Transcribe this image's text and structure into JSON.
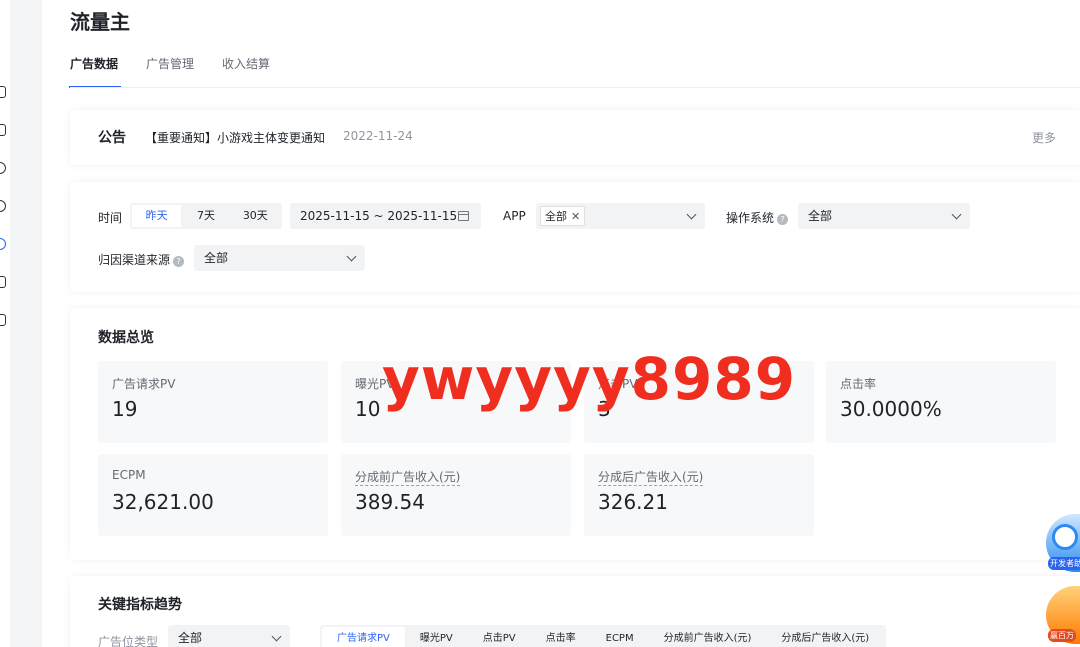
{
  "app": {
    "title": "流量主"
  },
  "tabs": [
    {
      "label": "广告数据",
      "active": true
    },
    {
      "label": "广告管理",
      "active": false
    },
    {
      "label": "收入结算",
      "active": false
    }
  ],
  "notice": {
    "label": "公告",
    "text": "【重要通知】小游戏主体变更通知",
    "date": "2022-11-24",
    "more": "更多"
  },
  "filters": {
    "time_label": "时间",
    "time_options": [
      {
        "label": "昨天",
        "active": true
      },
      {
        "label": "7天",
        "active": false
      },
      {
        "label": "30天",
        "active": false
      }
    ],
    "date_range": "2025-11-15 ~ 2025-11-15",
    "app_label": "APP",
    "app_tag": "全部",
    "os_label": "操作系统",
    "os_value": "全部",
    "channel_label": "归因渠道来源",
    "channel_value": "全部"
  },
  "overview": {
    "title": "数据总览",
    "stats": [
      {
        "label": "广告请求PV",
        "value": "19"
      },
      {
        "label": "曝光PV",
        "value": "10"
      },
      {
        "label": "点击PV",
        "value": "3"
      },
      {
        "label": "点击率",
        "value": "30.0000%"
      },
      {
        "label": "ECPM",
        "value": "32,621.00"
      },
      {
        "label": "分成前广告收入(元)",
        "value": "389.54"
      },
      {
        "label": "分成后广告收入(元)",
        "value": "326.21"
      }
    ]
  },
  "watermark": "ywyyyy8989",
  "floating": {
    "dev_label": "开发者助",
    "orange_label": "赢百万"
  },
  "trend": {
    "title": "关键指标趋势",
    "slot_type_label": "广告位类型",
    "slot_type_value": "全部",
    "metrics": [
      {
        "label": "广告请求PV",
        "active": true
      },
      {
        "label": "曝光PV",
        "active": false
      },
      {
        "label": "点击PV",
        "active": false
      },
      {
        "label": "点击率",
        "active": false
      },
      {
        "label": "ECPM",
        "active": false
      },
      {
        "label": "分成前广告收入(元)",
        "active": false
      },
      {
        "label": "分成后广告收入(元)",
        "active": false
      }
    ]
  },
  "colors": {
    "accent": "#2b64f0",
    "watermark": "#f02e20"
  }
}
